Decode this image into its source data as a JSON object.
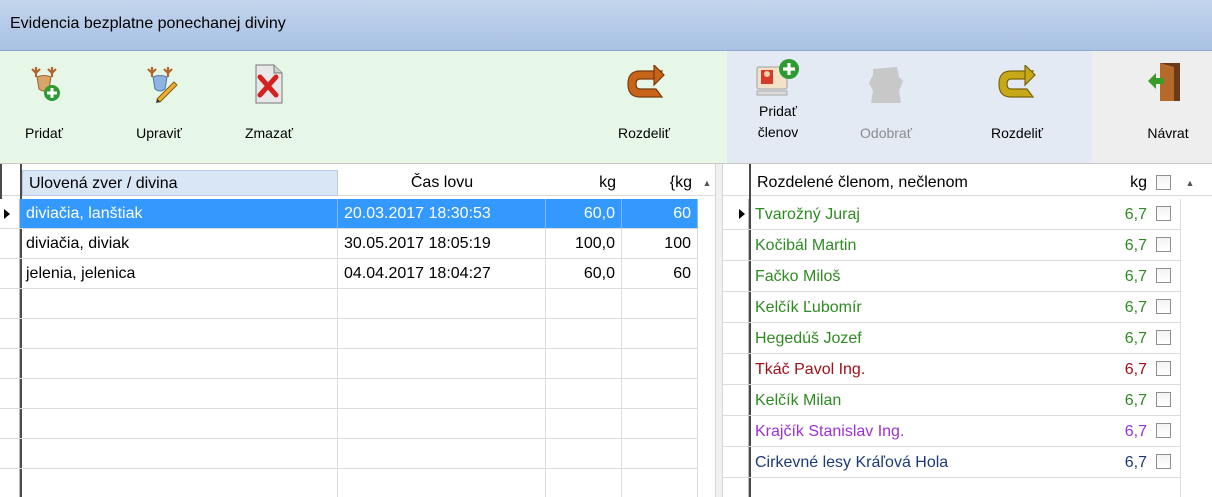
{
  "window": {
    "title": "Evidencia bezplatne ponechanej diviny"
  },
  "toolbar_left": {
    "add_label": "Pridať",
    "edit_label": "Upraviť",
    "delete_label": "Zmazať",
    "split_label": "Rozdeliť"
  },
  "toolbar_right": {
    "add_members_line1": "Pridať",
    "add_members_line2": "členov",
    "remove_label": "Odobrať",
    "split_label": "Rozdeliť"
  },
  "exit": {
    "label": "Návrat"
  },
  "game_table": {
    "columns": [
      "Ulovená zver / divina",
      "Čas lovu",
      "kg",
      "{kg"
    ],
    "rows": [
      {
        "name": "diviačia, lanštiak",
        "time": "20.03.2017 18:30:53",
        "kg": "60,0",
        "kg2": "60",
        "selected": true
      },
      {
        "name": "diviačia, diviak",
        "time": "30.05.2017 18:05:19",
        "kg": "100,0",
        "kg2": "100",
        "selected": false
      },
      {
        "name": "jelenia, jelenica",
        "time": "04.04.2017 18:04:27",
        "kg": "60,0",
        "kg2": "60",
        "selected": false
      }
    ]
  },
  "members_table": {
    "columns": [
      "Rozdelené členom, nečlenom",
      "kg"
    ],
    "rows": [
      {
        "name": "Tvarožný Juraj",
        "kg": "6,7",
        "color": "#2e8b22"
      },
      {
        "name": "Kočibál Martin",
        "kg": "6,7",
        "color": "#2e8b22"
      },
      {
        "name": "Fačko Miloš",
        "kg": "6,7",
        "color": "#2e8b22"
      },
      {
        "name": "Kelčík Ľubomír",
        "kg": "6,7",
        "color": "#2e8b22"
      },
      {
        "name": "Hegedúš Jozef",
        "kg": "6,7",
        "color": "#2e8b22"
      },
      {
        "name": "Tkáč Pavol Ing.",
        "kg": "6,7",
        "color": "#a0101a"
      },
      {
        "name": "Kelčík Milan",
        "kg": "6,7",
        "color": "#2e8b22"
      },
      {
        "name": "Krajčík Stanislav Ing.",
        "kg": "6,7",
        "color": "#9b30d8"
      },
      {
        "name": "Cirkevné lesy Kráľová Hola",
        "kg": "6,7",
        "color": "#1c3a7a"
      }
    ]
  },
  "colors": {
    "selection": "#3399ff",
    "title_bar": "#b3c9e8",
    "left_toolbar_bg": "#e6f7e7",
    "right_toolbar_bg": "#e3eaf4"
  }
}
